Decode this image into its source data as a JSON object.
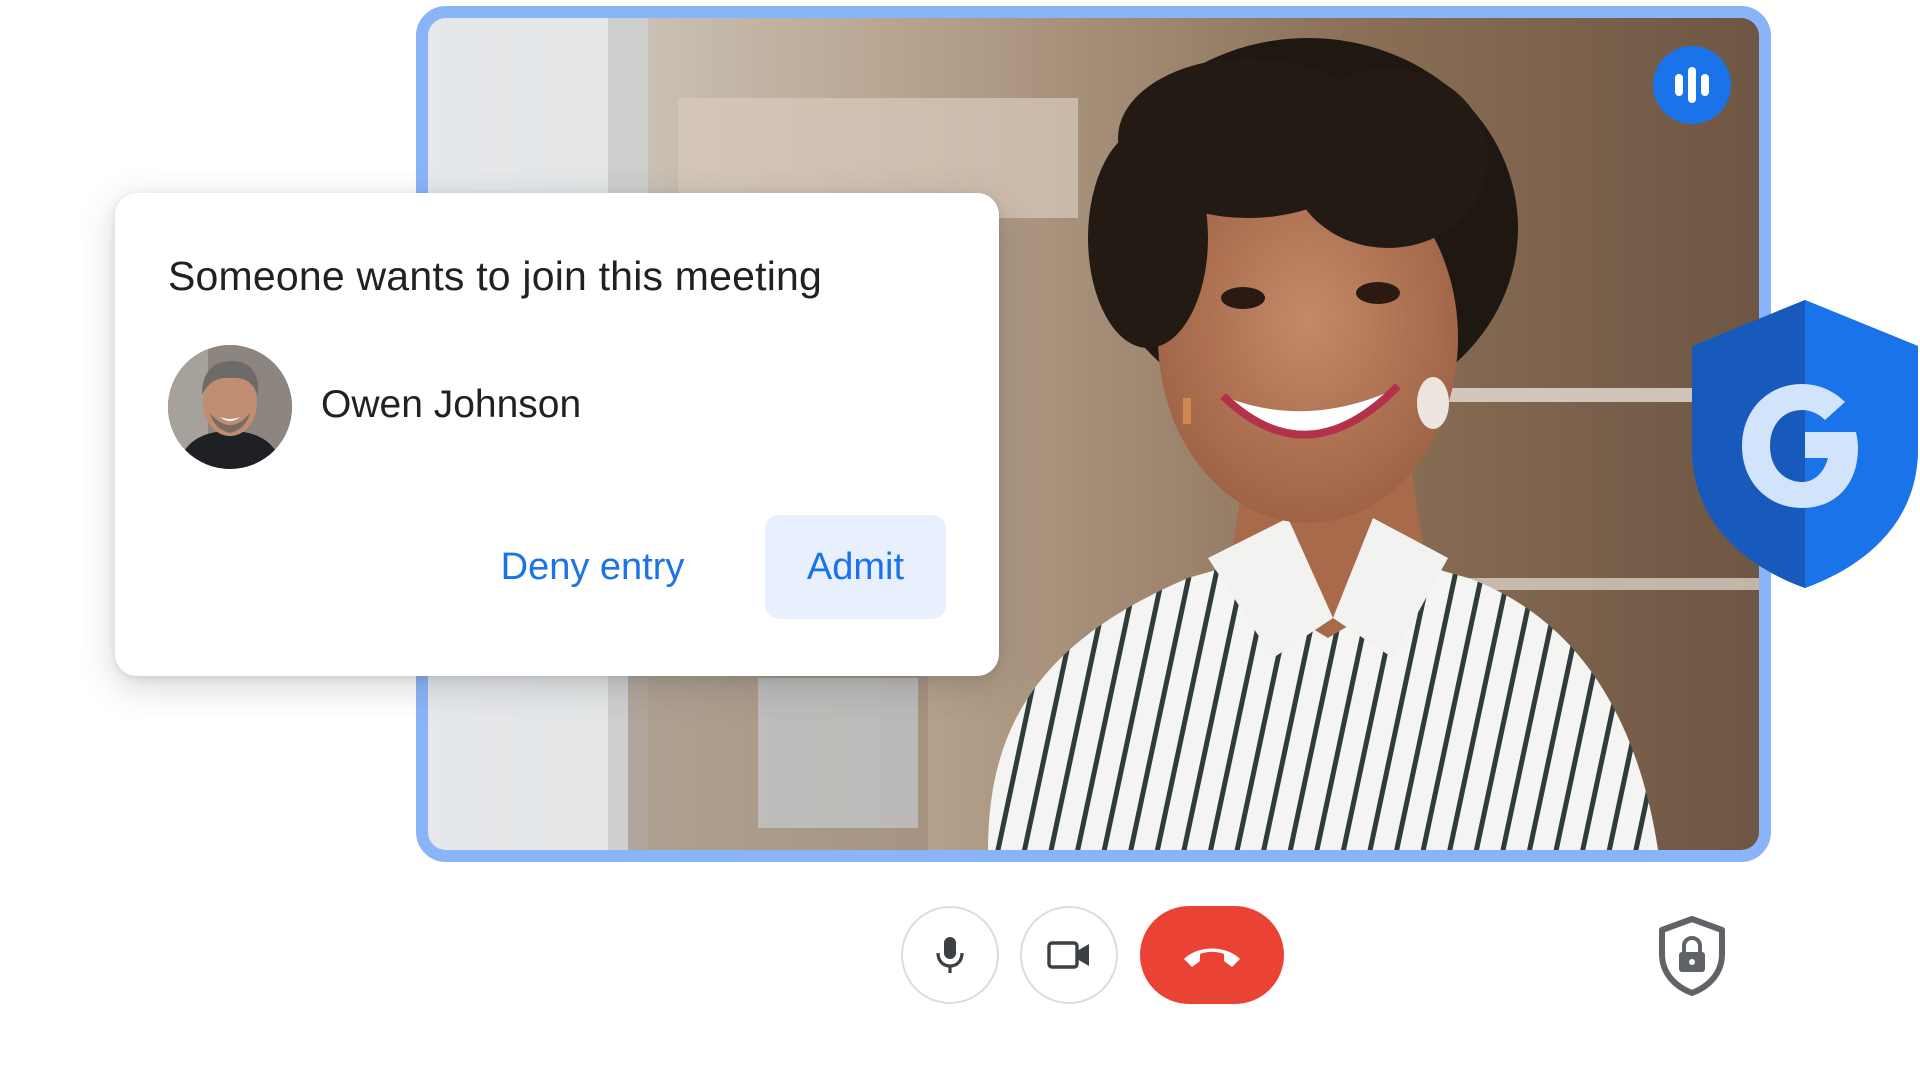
{
  "join_request": {
    "title": "Someone wants to join this meeting",
    "requester_name": "Owen Johnson",
    "deny_label": "Deny entry",
    "admit_label": "Admit"
  },
  "icons": {
    "speaking": "audio-bars-icon",
    "security_badge": "google-shield-icon",
    "microphone": "microphone-icon",
    "camera": "video-camera-icon",
    "hang_up": "hang-up-phone-icon",
    "host_controls": "lock-shield-icon"
  },
  "colors": {
    "accent_blue": "#1a73e8",
    "frame_border": "#8ab4f8",
    "admit_bg": "#e8f0fe",
    "hang_up_red": "#ea4335",
    "text_dark": "#202124",
    "control_border": "#dadce0",
    "shield_blue": "#1a63d6"
  }
}
